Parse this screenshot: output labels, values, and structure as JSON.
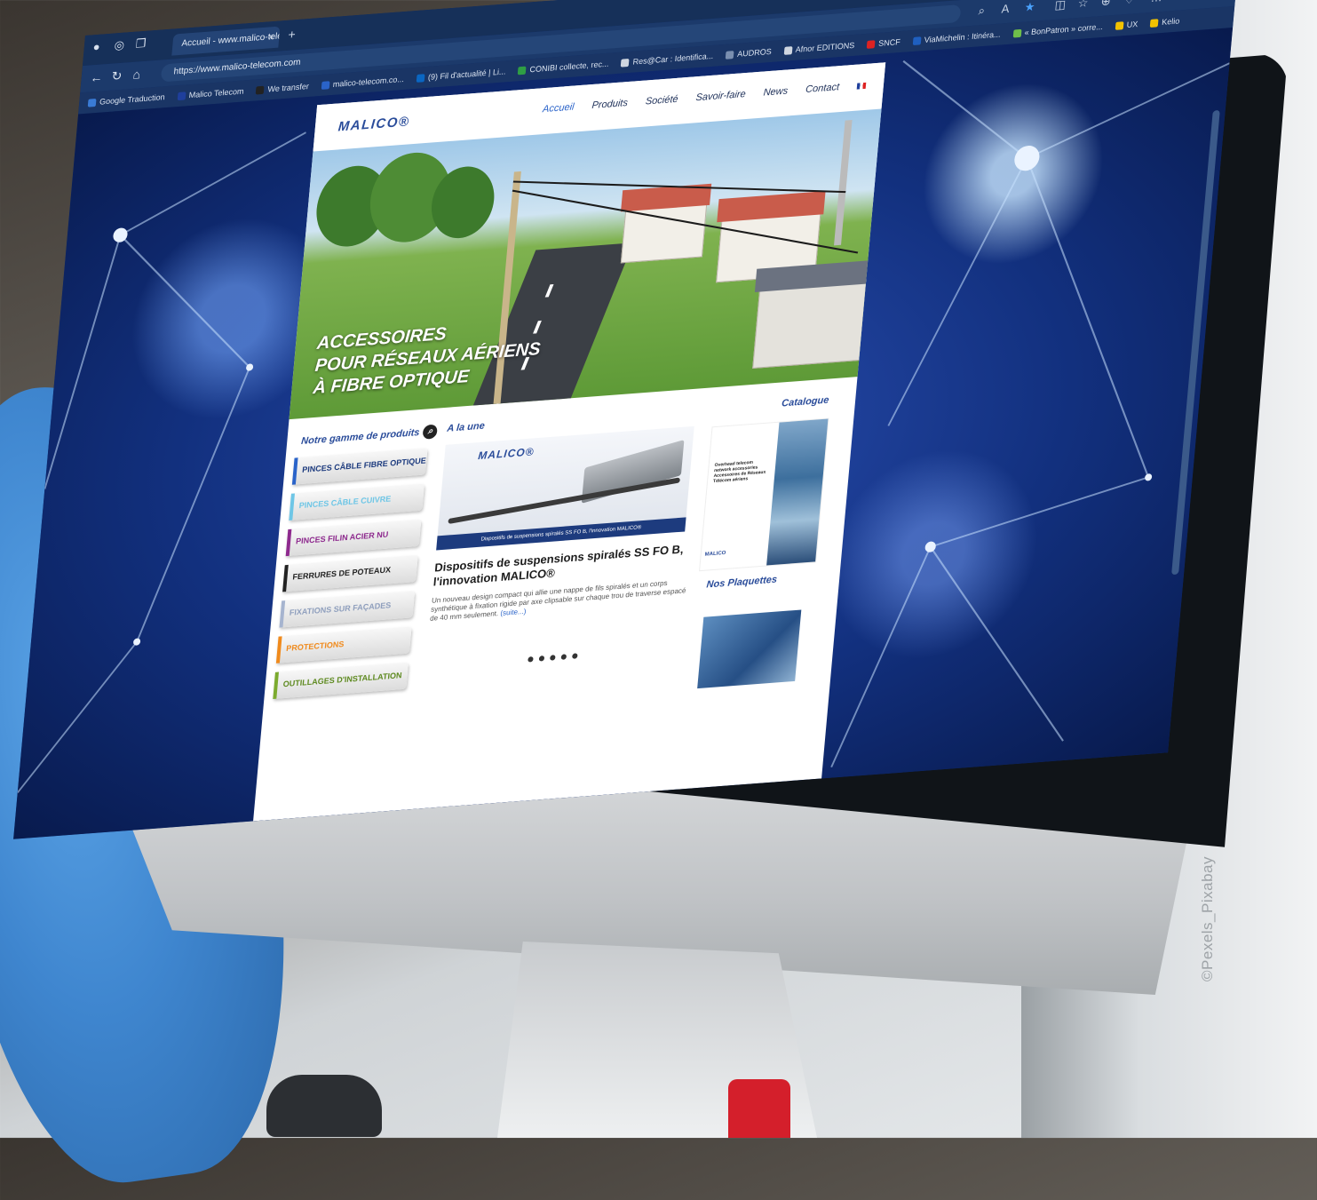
{
  "browser": {
    "tab_title": "Accueil - www.malico-telecom.c",
    "tab_close": "×",
    "new_tab": "+",
    "url": "https://www.malico-telecom.com",
    "bookmarks": [
      {
        "label": "Google Traduction",
        "color": "#3a7bd5"
      },
      {
        "label": "Malico Telecom",
        "color": "#1f3f9c"
      },
      {
        "label": "We transfer",
        "color": "#222222"
      },
      {
        "label": "malico-telecom.co...",
        "color": "#2a63c9"
      },
      {
        "label": "(9) Fil d'actualité | Li...",
        "color": "#0a66c2"
      },
      {
        "label": "CONIBI collecte, rec...",
        "color": "#2f9e44"
      },
      {
        "label": "Res@Car : Identifica...",
        "color": "#cfd6e0"
      },
      {
        "label": "AUDROS",
        "color": "#7a8fb0"
      },
      {
        "label": "Afnor EDITIONS",
        "color": "#cfd6e0"
      },
      {
        "label": "SNCF",
        "color": "#d22"
      },
      {
        "label": "ViaMichelin : Itinéra...",
        "color": "#1f5fbf"
      },
      {
        "label": "« BonPatron » corre...",
        "color": "#6fbf4a"
      },
      {
        "label": "UX",
        "color": "#f2c200"
      },
      {
        "label": "Kelio",
        "color": "#f2c200"
      }
    ]
  },
  "site": {
    "logo": "MALICO®",
    "nav": [
      "Accueil",
      "Produits",
      "Société",
      "Savoir-faire",
      "News",
      "Contact"
    ],
    "hero_title": [
      "ACCESSOIRES",
      "POUR RÉSEAUX AÉRIENS",
      "À FIBRE OPTIQUE"
    ],
    "products_title": "Notre gamme de produits",
    "products": [
      {
        "label": "PINCES CÂBLE FIBRE OPTIQUE",
        "color": "#2a63c9",
        "text_color": "#1d3b7e"
      },
      {
        "label": "PINCES CÂBLE CUIVRE",
        "color": "#6ec6e6",
        "text_color": "#6ec6e6"
      },
      {
        "label": "PINCES FILIN ACIER NU",
        "color": "#8e2a8e",
        "text_color": "#8e2a8e"
      },
      {
        "label": "FERRURES DE POTEAUX",
        "color": "#222222",
        "text_color": "#222222"
      },
      {
        "label": "FIXATIONS SUR FAÇADES",
        "color": "#a6b4cf",
        "text_color": "#8f9fbd"
      },
      {
        "label": "PROTECTIONS",
        "color": "#f08a1c",
        "text_color": "#f08a1c"
      },
      {
        "label": "OUTILLAGES D'INSTALLATION",
        "color": "#7cab2f",
        "text_color": "#5e8a20"
      }
    ],
    "une_title": "A la une",
    "banner_logo": "MALICO®",
    "banner_caption": "Dispositifs de suspensions spiralés SS FO B, l'innovation MALICO®",
    "article_title": "Dispositifs de suspensions spiralés SS FO B, l'innovation MALICO®",
    "article_body": "Un nouveau design compact qui allie une nappe de fils spiralés et un corps synthétique à fixation rigide par axe clipsable sur chaque trou de traverse espacé de 40 mm seulement.",
    "article_more": "(suite...)",
    "carousel_dots": "●●●●●",
    "catalogue_title": "Catalogue",
    "brochure_text": "Overhead telecom network accessories Accessoires de Réseaux Télécom aériens",
    "brochure_logo": "MALICO",
    "plaquettes_title": "Nos Plaquettes"
  },
  "credit": "©Pexels_Pixabay"
}
